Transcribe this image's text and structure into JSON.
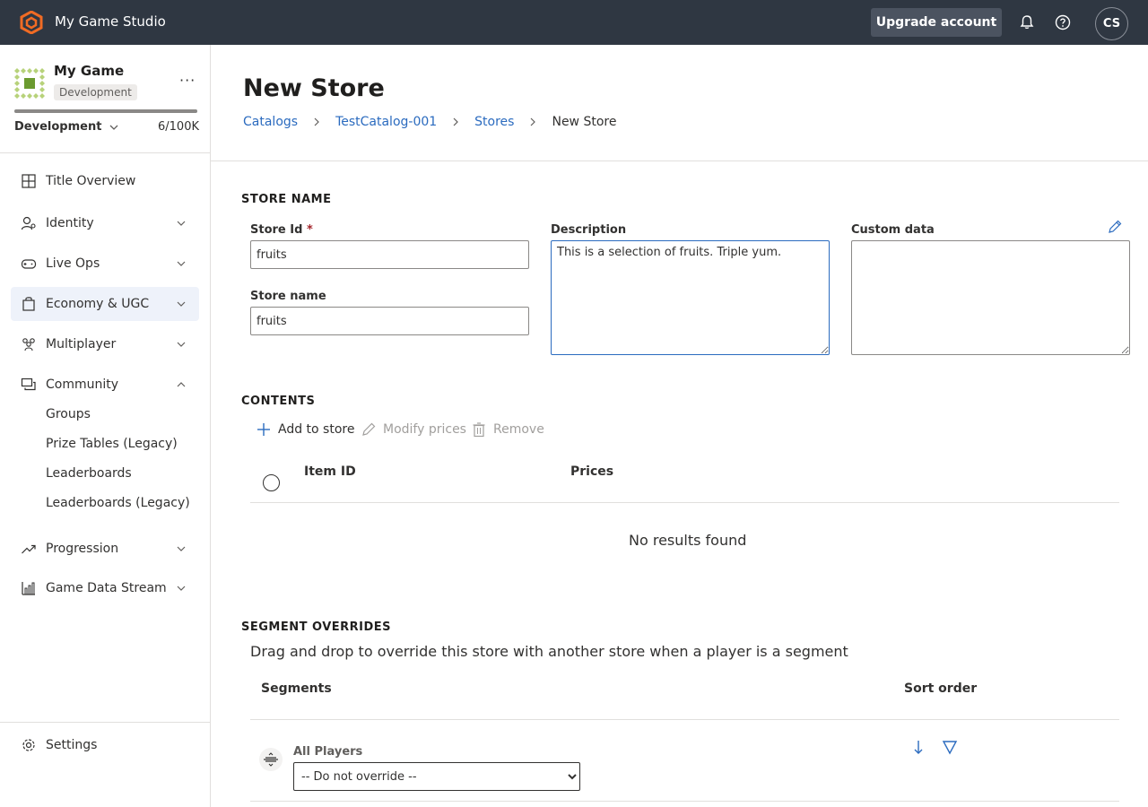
{
  "topbar": {
    "studio_name": "My Game Studio",
    "upgrade_label": "Upgrade account",
    "avatar_initials": "CS",
    "icons": [
      "studio-logo-icon",
      "bell-icon",
      "help-icon"
    ]
  },
  "sidebar": {
    "game_name": "My Game",
    "environment_badge": "Development",
    "environment_selector": "Development",
    "usage_count": "6/100K",
    "items": [
      {
        "label": "Title Overview",
        "icon": "grid-icon"
      },
      {
        "label": "Identity",
        "icon": "identity-icon"
      },
      {
        "label": "Live Ops",
        "icon": "gamepad-icon"
      },
      {
        "label": "Economy & UGC",
        "icon": "bag-icon"
      },
      {
        "label": "Multiplayer",
        "icon": "people-icon"
      },
      {
        "label": "Community",
        "icon": "chat-icon"
      },
      {
        "label": "Progression",
        "icon": "trending-icon"
      },
      {
        "label": "Game Data Stream",
        "icon": "bar-chart-icon"
      }
    ],
    "community_sub_items": [
      "Groups",
      "Prize Tables (Legacy)",
      "Leaderboards",
      "Leaderboards (Legacy)"
    ],
    "settings_label": "Settings"
  },
  "main": {
    "title": "New Store",
    "breadcrumb": [
      "Catalogs",
      "TestCatalog-001",
      "Stores",
      "New Store"
    ],
    "store_name_section": {
      "title": "STORE NAME",
      "store_id_label": "Store Id",
      "required_mark": "*",
      "store_id_value": "fruits",
      "store_name_label": "Store name",
      "store_name_value": "fruits",
      "description_label": "Description",
      "description_value": "This is a selection of fruits. Triple yum.",
      "custom_data_label": "Custom data",
      "custom_data_value": ""
    },
    "contents": {
      "title": "CONTENTS",
      "add_label": "Add to store",
      "modify_label": "Modify prices",
      "remove_label": "Remove",
      "columns": [
        "Item ID",
        "Prices"
      ],
      "empty_message": "No results found"
    },
    "segment_overrides": {
      "title": "SEGMENT OVERRIDES",
      "description": "Drag and drop to override this store with another store when a player is a segment",
      "columns": [
        "Segments",
        "Sort order"
      ],
      "rows": [
        {
          "segment": "All Players",
          "override": "-- Do not override --"
        }
      ]
    }
  }
}
